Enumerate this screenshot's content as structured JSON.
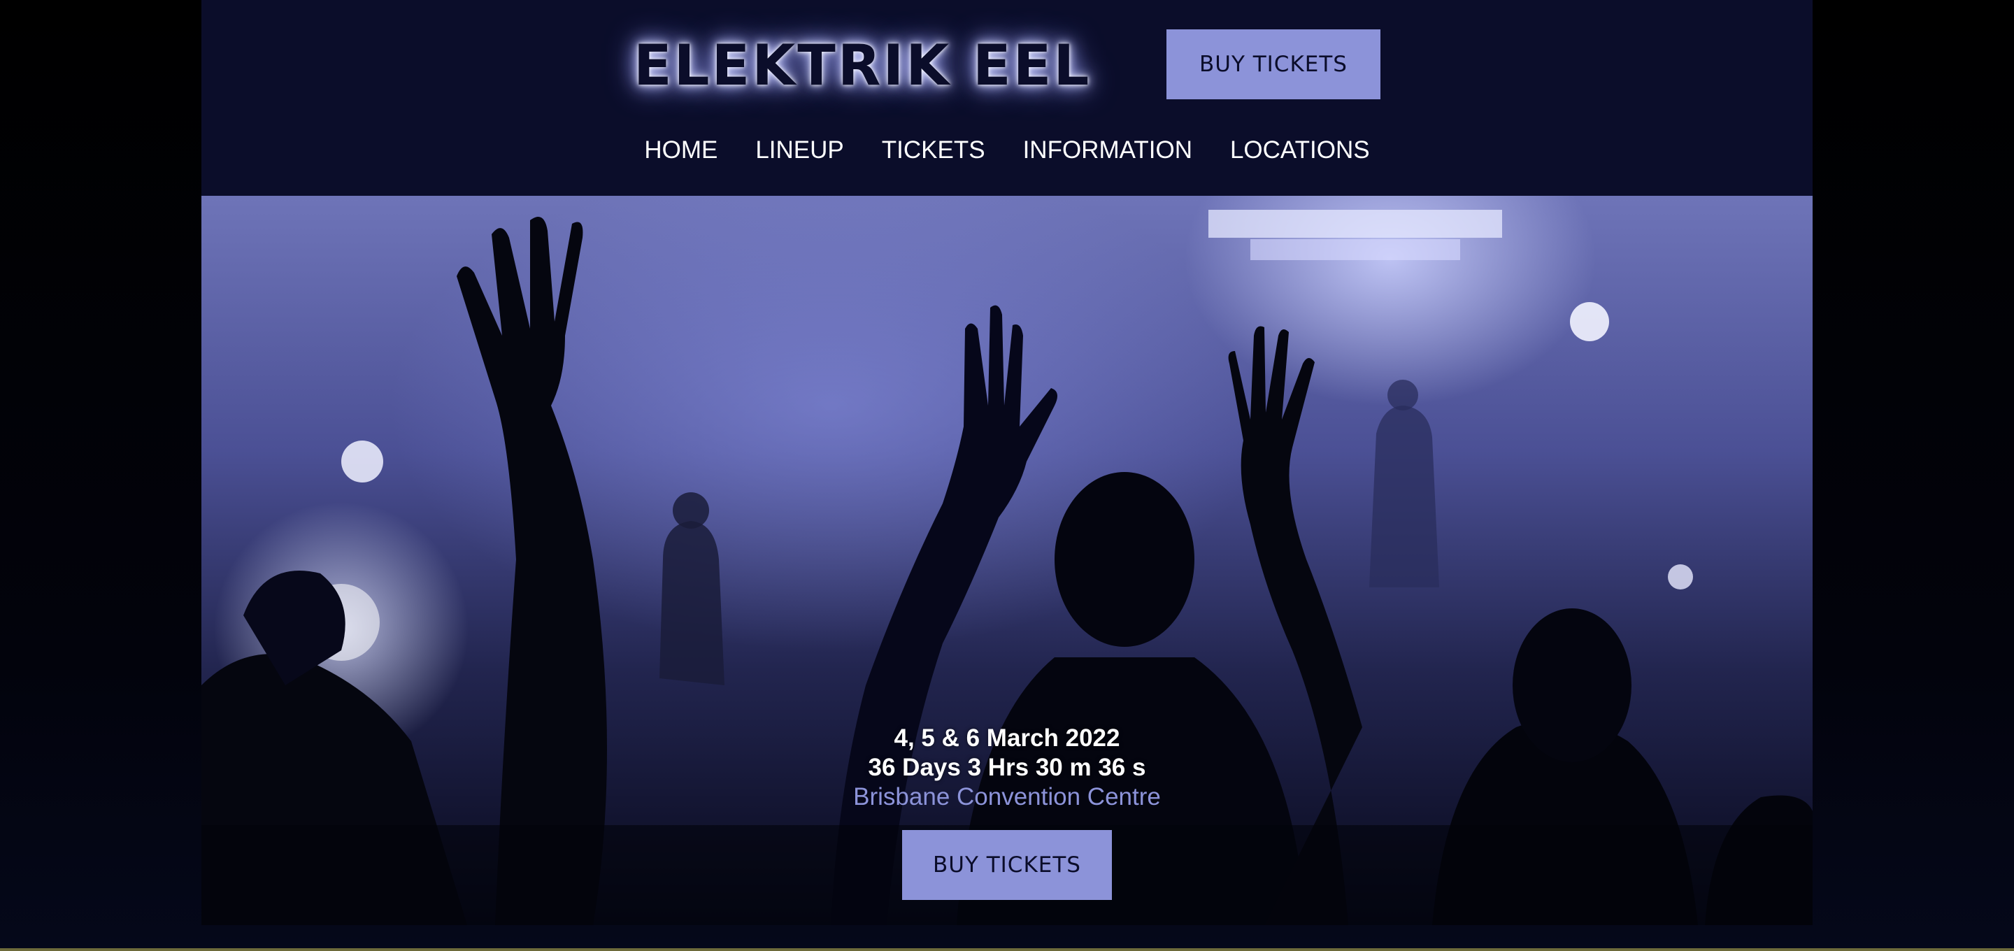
{
  "header": {
    "logo": "ELEKTRIK EEL",
    "buy_button": "BUY TICKETS"
  },
  "nav": {
    "items": [
      {
        "label": "HOME"
      },
      {
        "label": "LINEUP"
      },
      {
        "label": "TICKETS"
      },
      {
        "label": "INFORMATION"
      },
      {
        "label": "LOCATIONS"
      }
    ]
  },
  "hero": {
    "image_icon": "concert-crowd-photo",
    "date": "4, 5 & 6 March 2022",
    "countdown": "36 Days 3 Hrs 30 m 36 s",
    "venue": "Brisbane Convention Centre",
    "buy_button": "BUY TICKETS"
  },
  "colors": {
    "header_bg": "#0b0d2a",
    "accent": "#8c93d9",
    "text_light": "#ffffff"
  }
}
